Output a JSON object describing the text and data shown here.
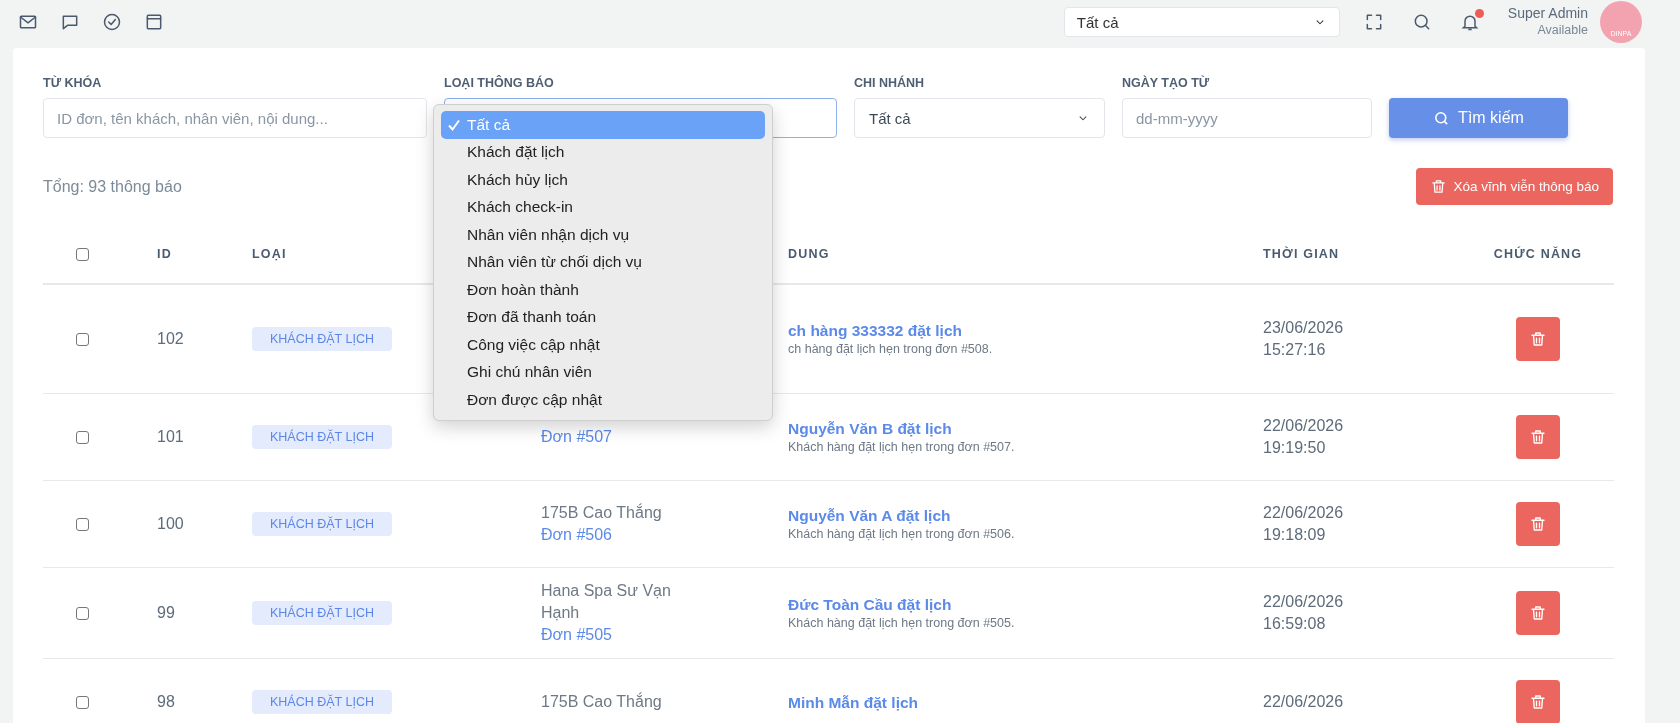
{
  "top_bar": {
    "branch_select": {
      "value": "Tất cả"
    },
    "user": {
      "name": "Super Admin",
      "status": "Available"
    },
    "logo_text": "DINPA"
  },
  "filters": {
    "keyword": {
      "label": "TỪ KHÓA",
      "placeholder": "ID đơn, tên khách, nhân viên, nội dung..."
    },
    "type": {
      "label": "LOẠI THÔNG BÁO",
      "expanded": true,
      "options": [
        {
          "label": "Tất cả",
          "selected": true
        },
        {
          "label": "Khách đặt lịch",
          "selected": false
        },
        {
          "label": "Khách hủy lịch",
          "selected": false
        },
        {
          "label": "Khách check-in",
          "selected": false
        },
        {
          "label": "Nhân viên nhận dịch vụ",
          "selected": false
        },
        {
          "label": "Nhân viên từ chối dịch vụ",
          "selected": false
        },
        {
          "label": "Đơn hoàn thành",
          "selected": false
        },
        {
          "label": "Đơn đã thanh toán",
          "selected": false
        },
        {
          "label": "Công việc cập nhật",
          "selected": false
        },
        {
          "label": "Ghi chú nhân viên",
          "selected": false
        },
        {
          "label": "Đơn được cập nhật",
          "selected": false
        }
      ]
    },
    "branch": {
      "label": "CHI NHÁNH",
      "value": "Tất cả"
    },
    "date_from": {
      "label": "NGÀY TẠO TỪ",
      "placeholder": "dd-mm-yyyy"
    },
    "search_button": "Tìm kiếm"
  },
  "total": "Tổng: 93 thông báo",
  "delete_all_button": "Xóa vĩnh viễn thông báo",
  "table": {
    "select_all": {
      "checked": false
    },
    "columns": {
      "id": "ID",
      "type": "LOẠI",
      "content": "DUNG",
      "time": "THỜI GIAN",
      "actions": "CHỨC NĂNG"
    },
    "rows": [
      {
        "checked": false,
        "id": "102",
        "type": "KHÁCH ĐẶT LỊCH",
        "title": "ch hàng 333332 đặt lịch",
        "description": "ch hàng đặt lịch hẹn trong đơn #508.",
        "date": "23/06/2026",
        "time": "15:27:16"
      },
      {
        "checked": false,
        "id": "101",
        "type": "KHÁCH ĐẶT LỊCH",
        "order": "Đơn #507",
        "title": "Nguyễn Văn B đặt lịch",
        "description": "Khách hàng đặt lịch hẹn trong đơn #507.",
        "date": "22/06/2026",
        "time": "19:19:50"
      },
      {
        "checked": false,
        "id": "100",
        "type": "KHÁCH ĐẶT LỊCH",
        "branch": "175B Cao Thắng",
        "order": "Đơn #506",
        "title": "Nguyễn Văn A đặt lịch",
        "description": "Khách hàng đặt lịch hẹn trong đơn #506.",
        "date": "22/06/2026",
        "time": "19:18:09"
      },
      {
        "checked": false,
        "id": "99",
        "type": "KHÁCH ĐẶT LỊCH",
        "branch": "Hana Spa Sư Vạn Hạnh",
        "order": "Đơn #505",
        "title": "Đức Toàn Cầu đặt lịch",
        "description": "Khách hàng đặt lịch hẹn trong đơn #505.",
        "date": "22/06/2026",
        "time": "16:59:08"
      },
      {
        "checked": false,
        "id": "98",
        "type": "KHÁCH ĐẶT LỊCH",
        "branch": "175B Cao Thắng",
        "title": "Minh Mẫn đặt lịch",
        "date": "22/06/2026"
      }
    ]
  }
}
